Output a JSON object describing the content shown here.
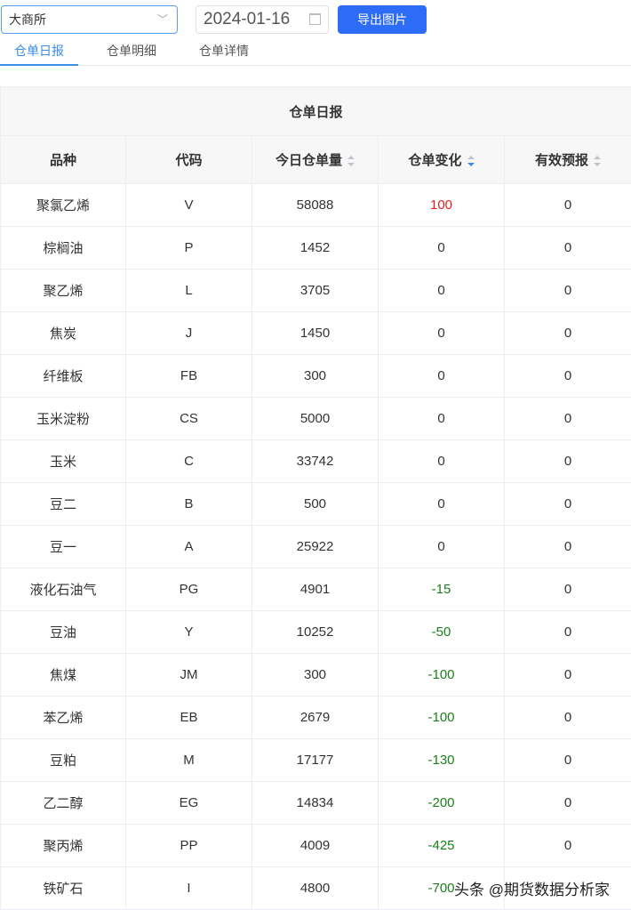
{
  "toolbar": {
    "exchange": "大商所",
    "date": "2024-01-16",
    "export_label": "导出图片"
  },
  "tabs": [
    "仓单日报",
    "仓单明细",
    "仓单详情"
  ],
  "table": {
    "title": "仓单日报",
    "headers": [
      "品种",
      "代码",
      "今日仓单量",
      "仓单变化",
      "有效预报"
    ],
    "rows": [
      [
        "聚氯乙烯",
        "V",
        "58088",
        "100",
        "0"
      ],
      [
        "棕榈油",
        "P",
        "1452",
        "0",
        "0"
      ],
      [
        "聚乙烯",
        "L",
        "3705",
        "0",
        "0"
      ],
      [
        "焦炭",
        "J",
        "1450",
        "0",
        "0"
      ],
      [
        "纤维板",
        "FB",
        "300",
        "0",
        "0"
      ],
      [
        "玉米淀粉",
        "CS",
        "5000",
        "0",
        "0"
      ],
      [
        "玉米",
        "C",
        "33742",
        "0",
        "0"
      ],
      [
        "豆二",
        "B",
        "500",
        "0",
        "0"
      ],
      [
        "豆一",
        "A",
        "25922",
        "0",
        "0"
      ],
      [
        "液化石油气",
        "PG",
        "4901",
        "-15",
        "0"
      ],
      [
        "豆油",
        "Y",
        "10252",
        "-50",
        "0"
      ],
      [
        "焦煤",
        "JM",
        "300",
        "-100",
        "0"
      ],
      [
        "苯乙烯",
        "EB",
        "2679",
        "-100",
        "0"
      ],
      [
        "豆粕",
        "M",
        "17177",
        "-130",
        "0"
      ],
      [
        "乙二醇",
        "EG",
        "14834",
        "-200",
        "0"
      ],
      [
        "聚丙烯",
        "PP",
        "4009",
        "-425",
        "0"
      ],
      [
        "铁矿石",
        "I",
        "4800",
        "-700",
        ""
      ]
    ]
  },
  "watermark": "头条 @期货数据分析家",
  "colors": {
    "accent": "#2d6cf6",
    "positive": "#e0201f",
    "negative": "#1a7f1a"
  }
}
